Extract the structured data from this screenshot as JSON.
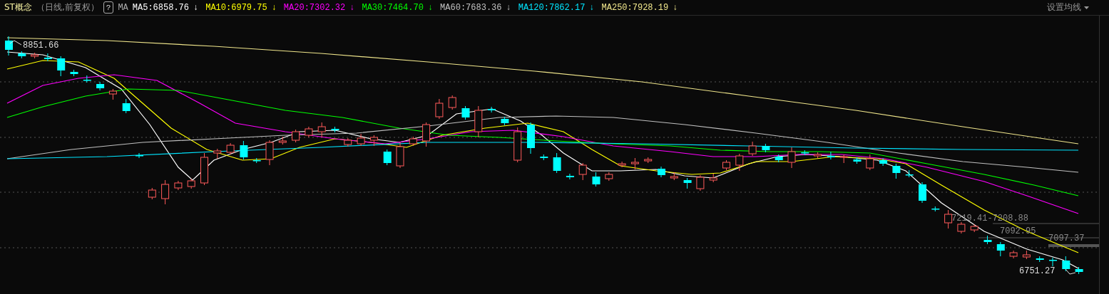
{
  "header": {
    "title": "ST概念",
    "subtitle": "（日线,前复权）",
    "help": "?",
    "ma_label": "MA",
    "averages": [
      {
        "label": "MA5:6858.76",
        "arrow": "↓",
        "color": "#ffffff"
      },
      {
        "label": "MA10:6979.75",
        "arrow": "↓",
        "color": "#ffff00"
      },
      {
        "label": "MA20:7302.32",
        "arrow": "↓",
        "color": "#ff00ff"
      },
      {
        "label": "MA30:7464.70",
        "arrow": "↓",
        "color": "#00ff00"
      },
      {
        "label": "MA60:7683.36",
        "arrow": "↓",
        "color": "#c0c0c0"
      },
      {
        "label": "MA120:7862.17",
        "arrow": "↓",
        "color": "#00e5ff"
      },
      {
        "label": "MA250:7928.19",
        "arrow": "↓",
        "color": "#f0e68c"
      }
    ],
    "settings": "设置均线"
  },
  "chart": {
    "high_label": "8851.66",
    "low_label": "6751.27",
    "range_labels": [
      "7219.41-7208.88",
      "7092.95",
      "7097.37"
    ]
  }
}
